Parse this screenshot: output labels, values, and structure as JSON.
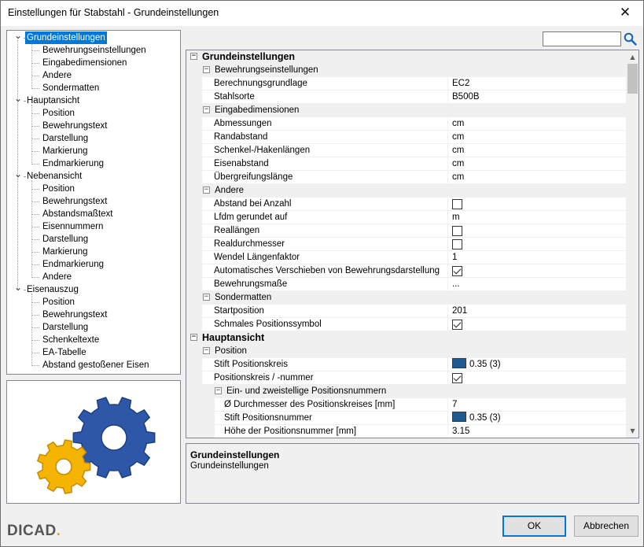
{
  "window": {
    "title": "Einstellungen für Stabstahl - Grundeinstellungen",
    "close_glyph": "✕"
  },
  "search": {
    "value": "",
    "placeholder": ""
  },
  "tree": [
    {
      "label": "Grundeinstellungen",
      "level": 0,
      "expanded": true,
      "selected": true
    },
    {
      "label": "Bewehrungseinstellungen",
      "level": 1
    },
    {
      "label": "Eingabedimensionen",
      "level": 1
    },
    {
      "label": "Andere",
      "level": 1
    },
    {
      "label": "Sondermatten",
      "level": 1
    },
    {
      "label": "Hauptansicht",
      "level": 0,
      "expanded": true
    },
    {
      "label": "Position",
      "level": 1
    },
    {
      "label": "Bewehrungstext",
      "level": 1
    },
    {
      "label": "Darstellung",
      "level": 1
    },
    {
      "label": "Markierung",
      "level": 1
    },
    {
      "label": "Endmarkierung",
      "level": 1
    },
    {
      "label": "Nebenansicht",
      "level": 0,
      "expanded": true
    },
    {
      "label": "Position",
      "level": 1
    },
    {
      "label": "Bewehrungstext",
      "level": 1
    },
    {
      "label": "Abstandsmaßtext",
      "level": 1
    },
    {
      "label": "Eisennummern",
      "level": 1
    },
    {
      "label": "Darstellung",
      "level": 1
    },
    {
      "label": "Markierung",
      "level": 1
    },
    {
      "label": "Endmarkierung",
      "level": 1
    },
    {
      "label": "Andere",
      "level": 1
    },
    {
      "label": "Eisenauszug",
      "level": 0,
      "expanded": true
    },
    {
      "label": "Position",
      "level": 1
    },
    {
      "label": "Bewehrungstext",
      "level": 1
    },
    {
      "label": "Darstellung",
      "level": 1
    },
    {
      "label": "Schenkeltexte",
      "level": 1
    },
    {
      "label": "EA-Tabelle",
      "level": 1
    },
    {
      "label": "Abstand gestoßener Eisen",
      "level": 1
    }
  ],
  "grid": [
    {
      "type": "cat",
      "level": 0,
      "name": "Grundeinstellungen"
    },
    {
      "type": "cat",
      "level": 1,
      "name": "Bewehrungseinstellungen"
    },
    {
      "type": "prop",
      "level": 1,
      "name": "Berechnungsgrundlage",
      "value": "EC2"
    },
    {
      "type": "prop",
      "level": 1,
      "name": "Stahlsorte",
      "value": "B500B"
    },
    {
      "type": "cat",
      "level": 1,
      "name": "Eingabedimensionen"
    },
    {
      "type": "prop",
      "level": 1,
      "name": "Abmessungen",
      "value": "cm"
    },
    {
      "type": "prop",
      "level": 1,
      "name": "Randabstand",
      "value": "cm"
    },
    {
      "type": "prop",
      "level": 1,
      "name": "Schenkel-/Hakenlängen",
      "value": "cm"
    },
    {
      "type": "prop",
      "level": 1,
      "name": "Eisenabstand",
      "value": "cm"
    },
    {
      "type": "prop",
      "level": 1,
      "name": "Übergreifungslänge",
      "value": "cm"
    },
    {
      "type": "cat",
      "level": 1,
      "name": "Andere"
    },
    {
      "type": "prop",
      "level": 1,
      "name": "Abstand bei Anzahl",
      "check": false
    },
    {
      "type": "prop",
      "level": 1,
      "name": "Lfdm gerundet auf",
      "value": "m"
    },
    {
      "type": "prop",
      "level": 1,
      "name": "Reallängen",
      "check": false
    },
    {
      "type": "prop",
      "level": 1,
      "name": "Realdurchmesser",
      "check": false
    },
    {
      "type": "prop",
      "level": 1,
      "name": "Wendel Längenfaktor",
      "value": "1"
    },
    {
      "type": "prop",
      "level": 1,
      "name": "Automatisches Verschieben von Bewehrungsdarstellung",
      "check": true
    },
    {
      "type": "prop",
      "level": 1,
      "name": "Bewehrungsmaße",
      "value": "..."
    },
    {
      "type": "cat",
      "level": 1,
      "name": "Sondermatten"
    },
    {
      "type": "prop",
      "level": 1,
      "name": "Startposition",
      "value": "201"
    },
    {
      "type": "prop",
      "level": 1,
      "name": "Schmales Positionssymbol",
      "check": true
    },
    {
      "type": "cat",
      "level": 0,
      "name": "Hauptansicht"
    },
    {
      "type": "cat",
      "level": 1,
      "name": "Position"
    },
    {
      "type": "prop",
      "level": 1,
      "name": "Stift Positionskreis",
      "value": "0.35 (3)",
      "swatch": "#1f5b93"
    },
    {
      "type": "prop",
      "level": 1,
      "name": "Positionskreis / -nummer",
      "check": true
    },
    {
      "type": "cat",
      "level": 2,
      "name": "Ein- und zweistellige Positionsnummern"
    },
    {
      "type": "prop",
      "level": 2,
      "name": "Ø Durchmesser des Positionskreises [mm]",
      "value": "7"
    },
    {
      "type": "prop",
      "level": 2,
      "name": "Stift Positionsnummer",
      "value": "0.35 (3)",
      "swatch": "#1f5b93"
    },
    {
      "type": "prop",
      "level": 2,
      "name": "Höhe der Positionsnummer [mm]",
      "value": "3.15"
    }
  ],
  "description": {
    "title": "Grundeinstellungen",
    "text": "Grundeinstellungen"
  },
  "footer": {
    "logo_text": "DICAD",
    "logo_dot": ".",
    "ok_label": "OK",
    "cancel_label": "Abbrechen"
  },
  "colors": {
    "accent": "#0078d7",
    "gear_blue": "#2e57a8",
    "gear_yellow": "#f4b400",
    "pen_swatch": "#1f5b93"
  }
}
